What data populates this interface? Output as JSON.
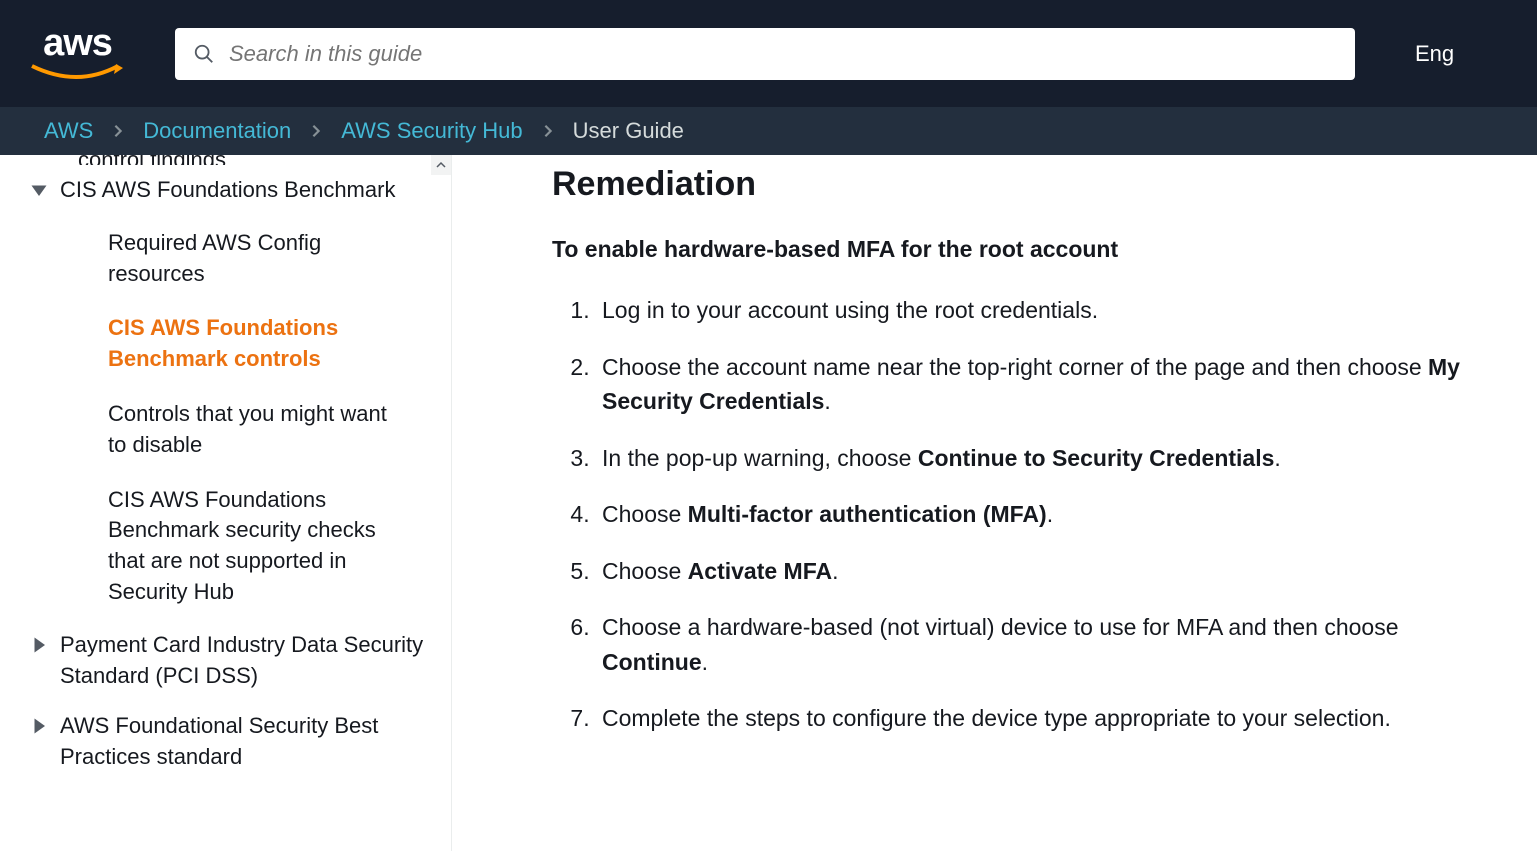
{
  "header": {
    "logo_text": "aws",
    "search_placeholder": "Search in this guide",
    "language": "Eng"
  },
  "breadcrumb": {
    "items": [
      "AWS",
      "Documentation",
      "AWS Security Hub"
    ],
    "current": "User Guide"
  },
  "sidebar": {
    "cutoff_text": "control findings",
    "expanded": {
      "label": "CIS AWS Foundations Benchmark",
      "children": [
        "Required AWS Config resources",
        "CIS AWS Foundations Benchmark controls",
        "Controls that you might want to disable",
        "CIS AWS Foundations Benchmark security checks that are not supported in Security Hub"
      ]
    },
    "collapsed": [
      "Payment Card Industry Data Security Standard (PCI DSS)",
      "AWS Foundational Security Best Practices standard"
    ]
  },
  "content": {
    "heading": "Remediation",
    "subtitle": "To enable hardware-based MFA for the root account",
    "steps": [
      {
        "pre": "Log in to your account using the root credentials."
      },
      {
        "pre": "Choose the account name near the top-right corner of the page and then choose ",
        "bold": "My Security Credentials",
        "post": "."
      },
      {
        "pre": "In the pop-up warning, choose ",
        "bold": "Continue to Security Credentials",
        "post": "."
      },
      {
        "pre": "Choose ",
        "bold": "Multi-factor authentication (MFA)",
        "post": "."
      },
      {
        "pre": "Choose ",
        "bold": "Activate MFA",
        "post": "."
      },
      {
        "pre": "Choose a hardware-based (not virtual) device to use for MFA and then choose ",
        "bold": "Continue",
        "post": "."
      },
      {
        "pre": "Complete the steps to configure the device type appropriate to your selection."
      }
    ]
  }
}
